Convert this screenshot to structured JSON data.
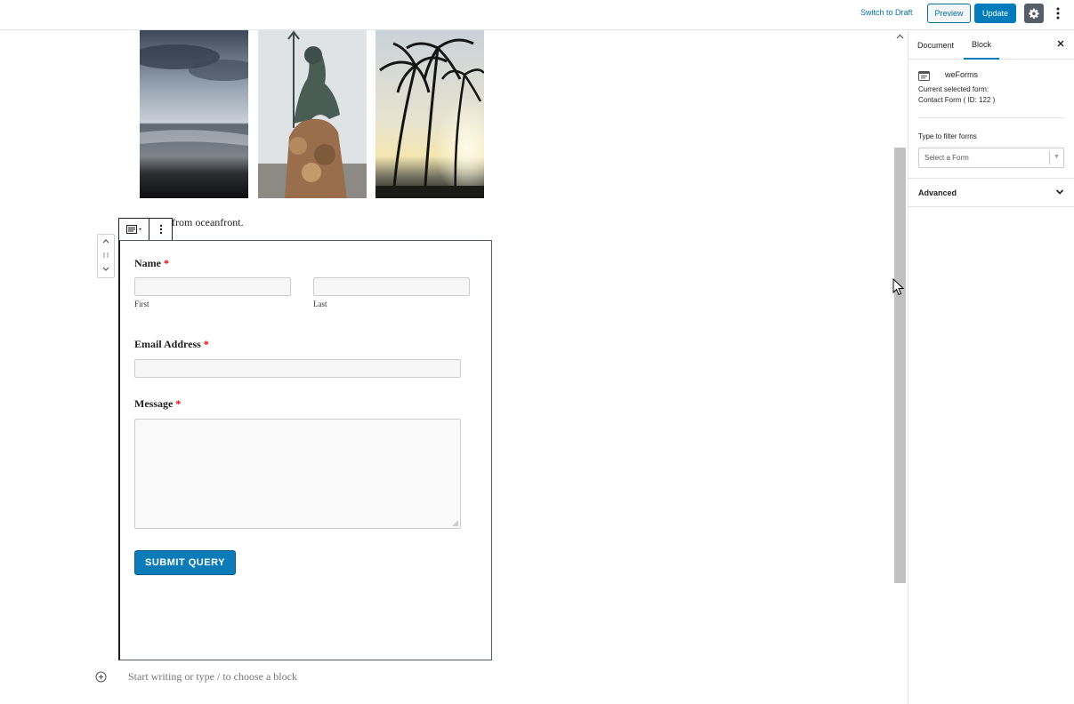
{
  "topbar": {
    "switch_to_draft": "Switch to Draft",
    "preview": "Preview",
    "update": "Update",
    "settings_icon": "gear-icon",
    "more_icon": "vertical-ellipsis-icon"
  },
  "editor": {
    "gallery": [
      {
        "alt": "cloudy ocean beach",
        "icon": "image"
      },
      {
        "alt": "neptune statue",
        "icon": "image"
      },
      {
        "alt": "palm trees sunset",
        "icon": "image"
      }
    ],
    "caption": "from oceanfront.",
    "form": {
      "name_label": "Name",
      "required_mark": "*",
      "first_sublabel": "First",
      "last_sublabel": "Last",
      "email_label": "Email Address",
      "message_label": "Message",
      "submit_label": "SUBMIT QUERY"
    },
    "appender_placeholder": "Start writing or type / to choose a block"
  },
  "sidebar": {
    "tabs": [
      "Document",
      "Block"
    ],
    "active_tab": "Block",
    "block_name": "weForms",
    "current_form_label": "Current selected form:",
    "current_form_value": "Contact Form ( ID: 122 )",
    "filter_label": "Type to filter forms",
    "select_placeholder": "Select a Form",
    "advanced_label": "Advanced"
  },
  "colors": {
    "primary": "#007cba",
    "submit": "#0b7cb8",
    "required": "#ee0000"
  }
}
